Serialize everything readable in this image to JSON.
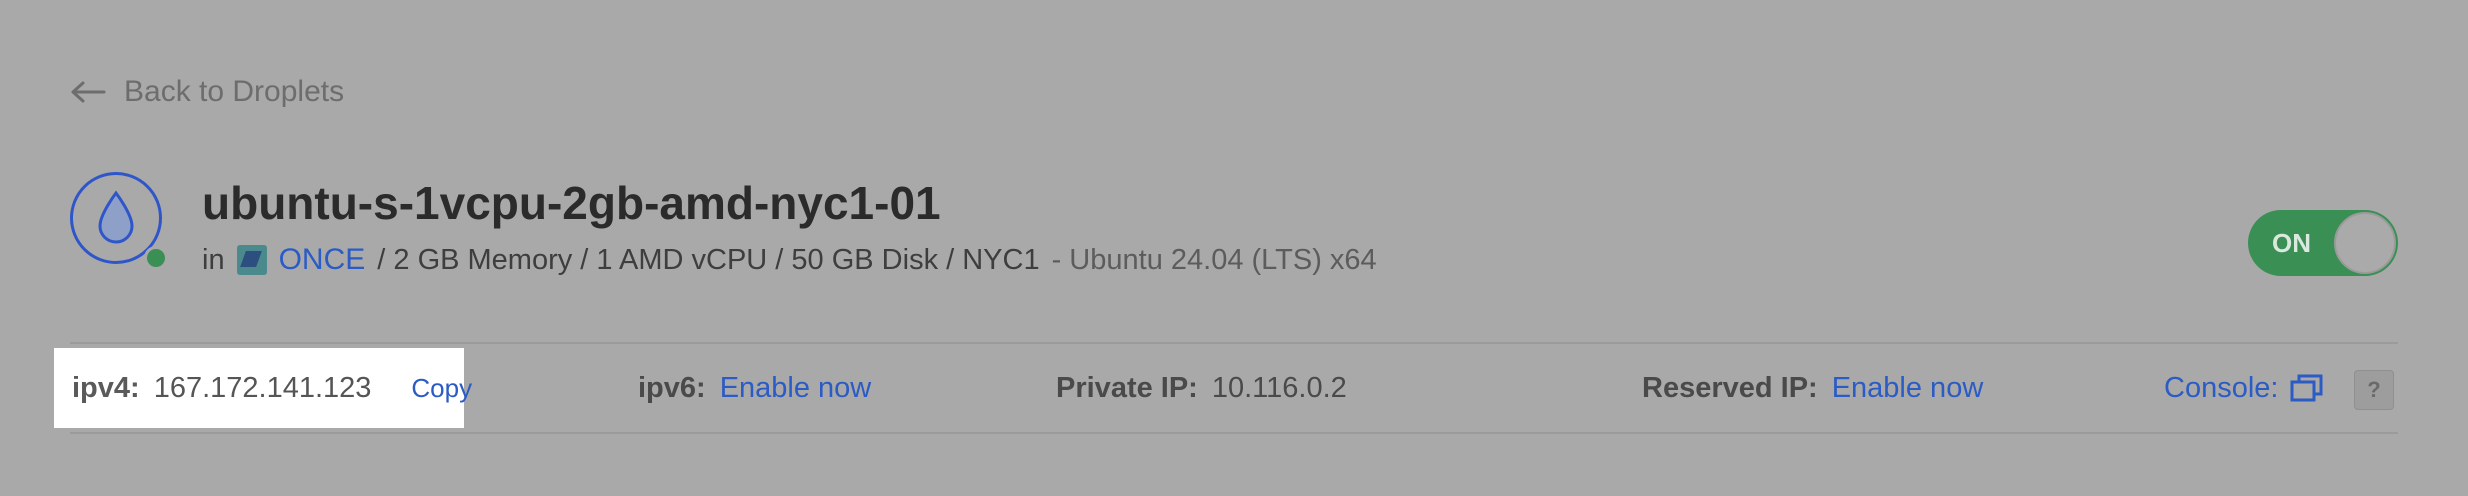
{
  "back_link": {
    "label": "Back to Droplets"
  },
  "droplet": {
    "name": "ubuntu-s-1vcpu-2gb-amd-nyc1-01",
    "in_label": "in",
    "project_name": "ONCE",
    "specs": "/ 2 GB Memory / 1 AMD vCPU / 50 GB Disk / NYC1",
    "os": "- Ubuntu 24.04 (LTS) x64",
    "power_toggle": {
      "label": "ON",
      "state": "on"
    }
  },
  "ip_row": {
    "ipv4": {
      "label": "ipv4:",
      "value": "167.172.141.123",
      "copy_label": "Copy"
    },
    "ipv6": {
      "label": "ipv6:",
      "action": "Enable now"
    },
    "private_ip": {
      "label": "Private IP:",
      "value": "10.116.0.2"
    },
    "reserved_ip": {
      "label": "Reserved IP:",
      "action": "Enable now"
    },
    "console": {
      "label": "Console:"
    },
    "help": {
      "label": "?"
    }
  },
  "colors": {
    "background": "#a9a9a9",
    "link": "#2b5bc4",
    "status_green": "#3a8f55",
    "logo_blue": "#2f56c9"
  },
  "icons": {
    "back": "arrow-left-icon",
    "logo": "droplet-icon",
    "project": "project-icon",
    "console": "external-window-icon"
  }
}
